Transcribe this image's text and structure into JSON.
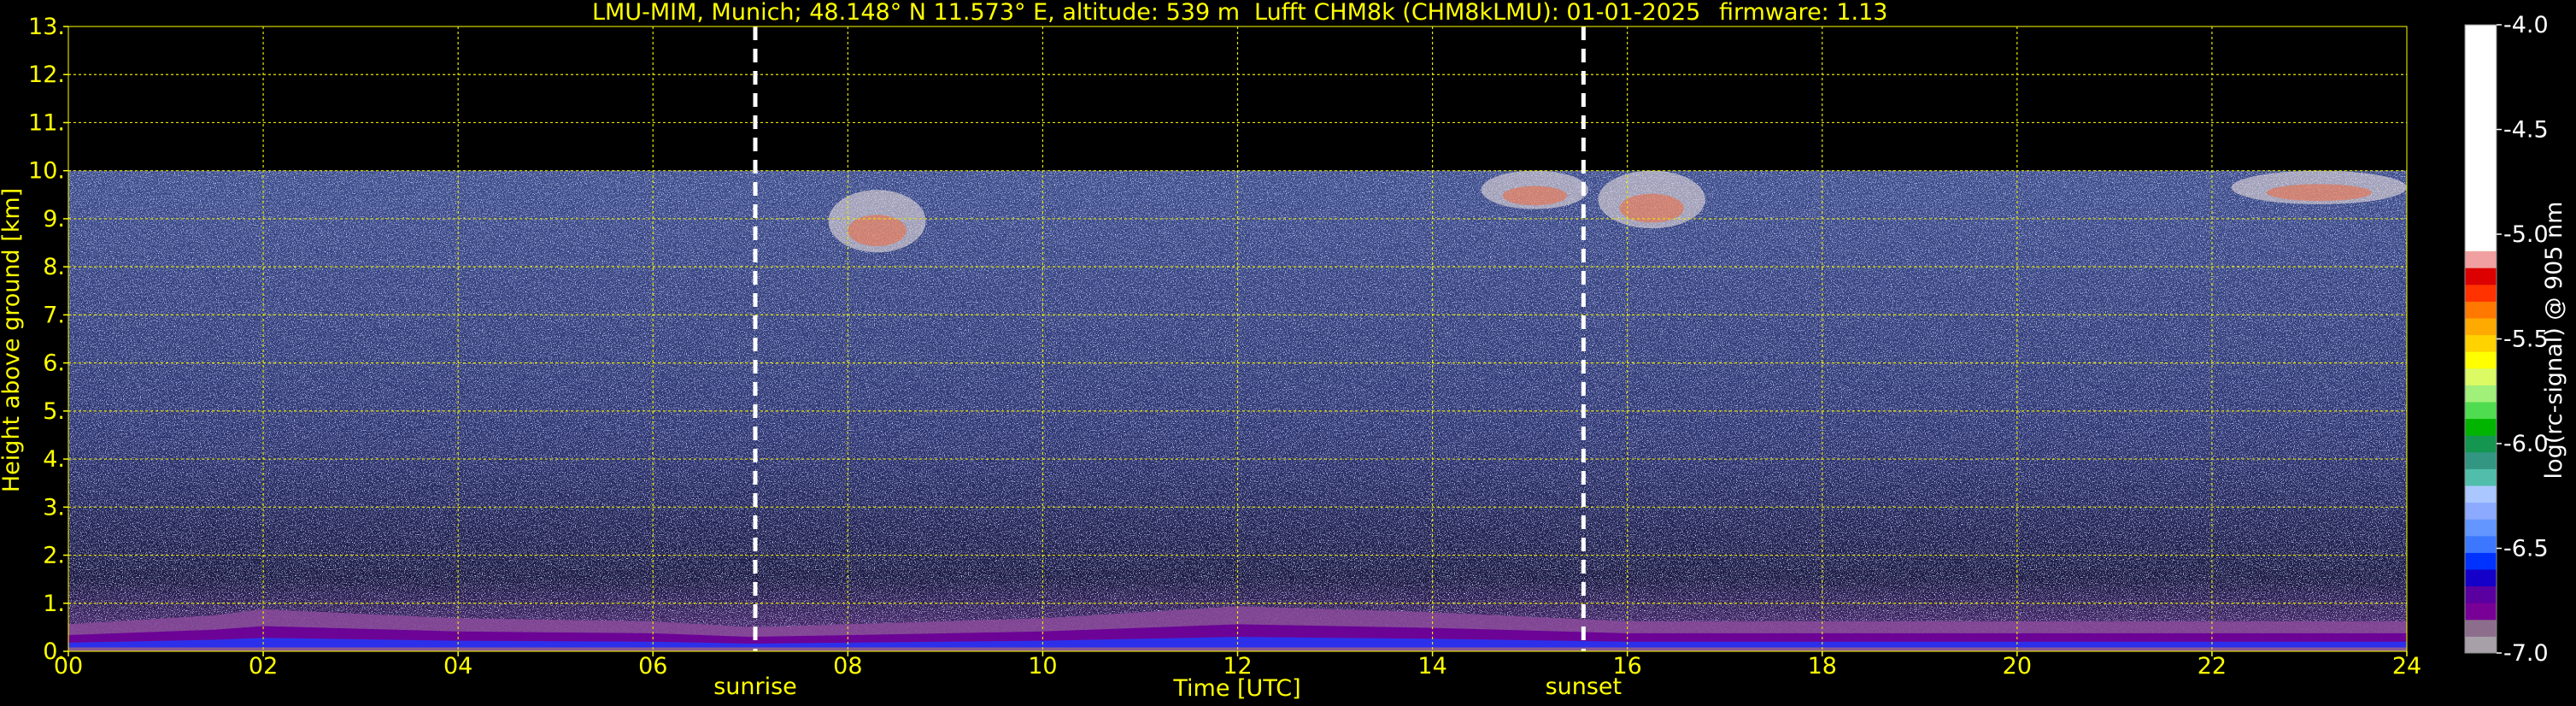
{
  "chart_data": {
    "type": "heatmap",
    "title_parts": [
      "LMU-MIM, Munich; 48.148° N 11.573° E, altitude: 539 m",
      "Lufft CHM8k (CHM8kLMU): 01-01-2025",
      "firmware: 1.13"
    ],
    "xlabel": "Time [UTC]",
    "ylabel": "Height above ground [km]",
    "xlim": [
      0,
      24
    ],
    "ylim": [
      0,
      13
    ],
    "x_ticks": [
      "00",
      "02",
      "04",
      "06",
      "08",
      "10",
      "12",
      "14",
      "16",
      "18",
      "20",
      "22",
      "24"
    ],
    "y_ticks": [
      "0.",
      "1.",
      "2.",
      "3.",
      "4.",
      "5.",
      "6.",
      "7.",
      "8.",
      "9.",
      "10.",
      "11.",
      "12.",
      "13."
    ],
    "grid": true,
    "data_top_km": 10,
    "markers": [
      {
        "label": "sunrise",
        "time": 7.05
      },
      {
        "label": "sunset",
        "time": 15.55
      }
    ],
    "colorbar": {
      "label": "log(rc-signal) @ 905 nm",
      "range": [
        -7.0,
        -4.0
      ],
      "ticks": [
        "-4.0",
        "-4.5",
        "-5.0",
        "-5.5",
        "-6.0",
        "-6.5",
        "-7.0"
      ],
      "tick_values": [
        -4.0,
        -4.5,
        -5.0,
        -5.5,
        -6.0,
        -6.5,
        -7.0
      ],
      "colors": [
        "#a8a0a8",
        "#8c6e8c",
        "#780096",
        "#5a00a0",
        "#1400c8",
        "#0032ff",
        "#3c78ff",
        "#6496ff",
        "#8caaff",
        "#aac8ff",
        "#50beaa",
        "#329682",
        "#149650",
        "#00b400",
        "#50dc50",
        "#a0f07a",
        "#dcfa64",
        "#ffff00",
        "#ffd200",
        "#ffaa00",
        "#ff7800",
        "#ff3200",
        "#dc0000",
        "#f0a0a0",
        "#f0d2d2",
        "#ffffff"
      ]
    },
    "clouds": [
      {
        "time_start": 14.5,
        "time_end": 15.6,
        "height_bottom_km": 9.2,
        "height_top_km": 10.0
      },
      {
        "time_start": 15.7,
        "time_end": 16.8,
        "height_bottom_km": 8.8,
        "height_top_km": 10.0
      },
      {
        "time_start": 22.2,
        "time_end": 24.0,
        "height_bottom_km": 9.3,
        "height_top_km": 10.0
      },
      {
        "time_start": 7.8,
        "time_end": 8.8,
        "height_bottom_km": 8.3,
        "height_top_km": 9.6
      }
    ],
    "boundary_layer": [
      {
        "time": 0,
        "top_km": 0.45
      },
      {
        "time": 1.5,
        "top_km": 0.6
      },
      {
        "time": 2.0,
        "top_km": 0.7
      },
      {
        "time": 4.0,
        "top_km": 0.55
      },
      {
        "time": 6.0,
        "top_km": 0.5
      },
      {
        "time": 7.0,
        "top_km": 0.4
      },
      {
        "time": 10.0,
        "top_km": 0.55
      },
      {
        "time": 12.0,
        "top_km": 0.75
      },
      {
        "time": 14.0,
        "top_km": 0.65
      },
      {
        "time": 16.0,
        "top_km": 0.5
      },
      {
        "time": 20.0,
        "top_km": 0.5
      },
      {
        "time": 24.0,
        "top_km": 0.5
      }
    ]
  }
}
